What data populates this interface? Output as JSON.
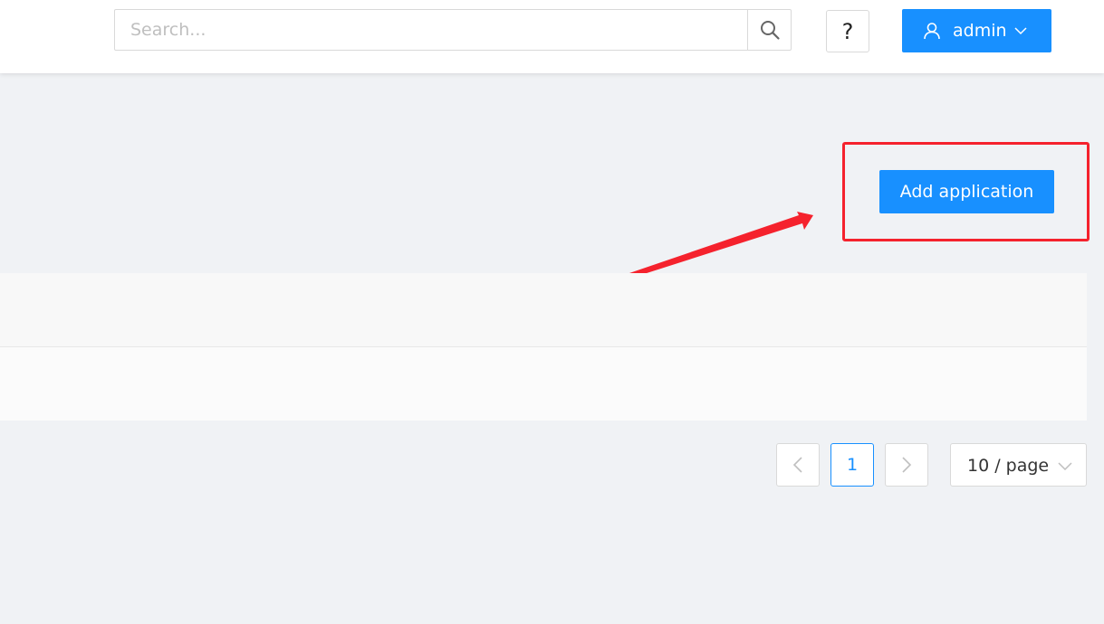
{
  "header": {
    "search": {
      "placeholder": "Search...",
      "value": ""
    },
    "help_label": "?",
    "user": {
      "name": "admin"
    }
  },
  "toolbar": {
    "add_label": "Add application"
  },
  "pagination": {
    "current_page": "1",
    "page_size_label": "10 / page"
  },
  "icons": {
    "search": "search-icon",
    "user": "user-icon",
    "caret": "chevron-down-icon",
    "prev": "chevron-left-icon",
    "next": "chevron-right-icon"
  },
  "colors": {
    "primary": "#1890ff",
    "annotation": "#f5222d",
    "background": "#f0f2f5"
  }
}
